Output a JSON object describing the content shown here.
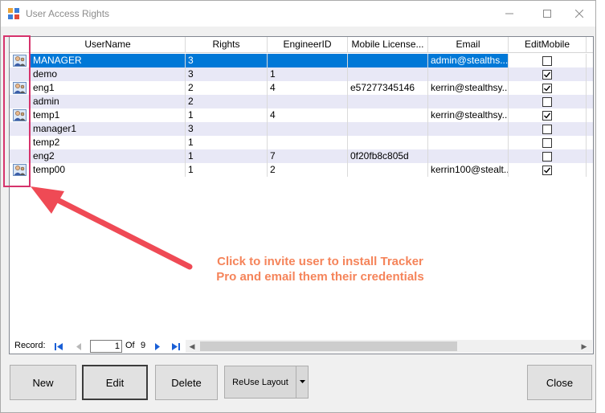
{
  "window": {
    "title": "User Access Rights"
  },
  "columns": [
    {
      "label": "UserName",
      "left": 0
    },
    {
      "label": "Rights"
    },
    {
      "label": "EngineerID"
    },
    {
      "label": "Mobile License..."
    },
    {
      "label": "Email"
    },
    {
      "label": "EditMobile"
    }
  ],
  "rows": [
    {
      "username": "MANAGER",
      "rights": "3",
      "engineer_id": "",
      "mobile_license": "",
      "email": "admin@stealths...",
      "edit_mobile": false,
      "has_icon": true,
      "selected": true
    },
    {
      "username": "demo",
      "rights": "3",
      "engineer_id": "1",
      "mobile_license": "",
      "email": "",
      "edit_mobile": true,
      "has_icon": false,
      "selected": false
    },
    {
      "username": "eng1",
      "rights": "2",
      "engineer_id": "4",
      "mobile_license": "e57277345146",
      "email": "kerrin@stealthsy...",
      "edit_mobile": true,
      "has_icon": true,
      "selected": false
    },
    {
      "username": "admin",
      "rights": "2",
      "engineer_id": "",
      "mobile_license": "",
      "email": "",
      "edit_mobile": false,
      "has_icon": false,
      "selected": false
    },
    {
      "username": "temp1",
      "rights": "1",
      "engineer_id": "4",
      "mobile_license": "",
      "email": "kerrin@stealthsy...",
      "edit_mobile": true,
      "has_icon": true,
      "selected": false
    },
    {
      "username": "manager1",
      "rights": "3",
      "engineer_id": "",
      "mobile_license": "",
      "email": "",
      "edit_mobile": false,
      "has_icon": false,
      "selected": false
    },
    {
      "username": "temp2",
      "rights": "1",
      "engineer_id": "",
      "mobile_license": "",
      "email": "",
      "edit_mobile": false,
      "has_icon": false,
      "selected": false
    },
    {
      "username": "eng2",
      "rights": "1",
      "engineer_id": "7",
      "mobile_license": "0f20fb8c805d",
      "email": "",
      "edit_mobile": false,
      "has_icon": false,
      "selected": false
    },
    {
      "username": "temp00",
      "rights": "1",
      "engineer_id": "2",
      "mobile_license": "",
      "email": "kerrin100@stealt...",
      "edit_mobile": true,
      "has_icon": true,
      "selected": false
    }
  ],
  "navigator": {
    "record_label": "Record:",
    "current": "1",
    "of_label": "Of",
    "count": "9"
  },
  "buttons": {
    "new": "New",
    "edit": "Edit",
    "delete": "Delete",
    "reuse_layout": "ReUse Layout",
    "close": "Close"
  },
  "annotation": {
    "text": "Click to invite user to install Tracker Pro and email them their credentials"
  },
  "colors": {
    "selection": "#0078d7",
    "alt_row": "#e8e8f6",
    "annotation": "#f5845a",
    "highlight_box": "#d6336c",
    "arrow": "#ef4a55"
  },
  "icons": {
    "app": "grid-app-icon",
    "user": "user-person-icon",
    "minimize": "minimize-icon",
    "maximize": "maximize-icon",
    "close": "close-icon"
  }
}
